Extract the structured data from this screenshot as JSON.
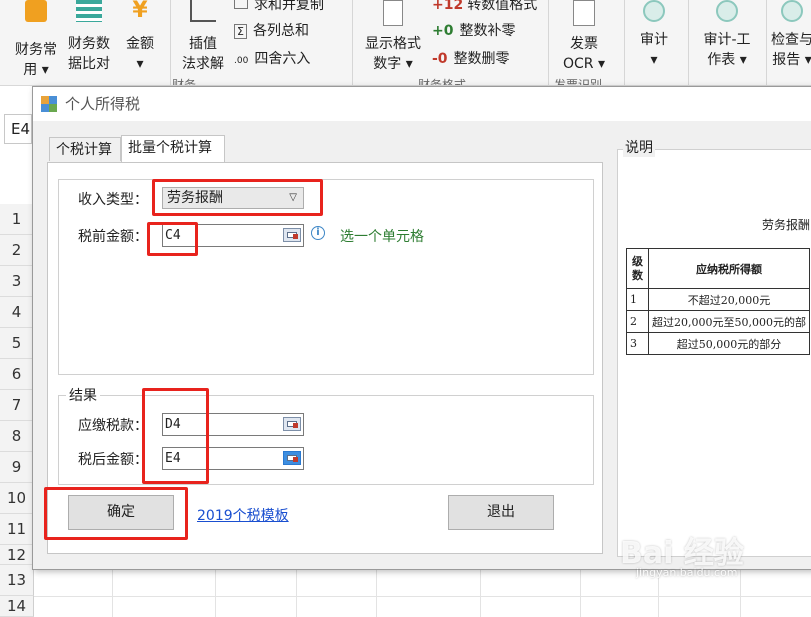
{
  "ribbon": {
    "buttons": [
      {
        "l1": "财务常",
        "l2": "用",
        "icon": "finance-common-icon"
      },
      {
        "l1": "财务数",
        "l2": "据比对",
        "icon": "data-compare-icon"
      },
      {
        "l1": "金额",
        "l2": "",
        "icon": "yen-icon"
      },
      {
        "l1": "插值",
        "l2": "法求解",
        "icon": "interpolation-icon"
      },
      {
        "l1": "显示格式",
        "l2": "数字",
        "icon": "display-format-icon"
      },
      {
        "l1": "发票",
        "l2": "OCR",
        "icon": "invoice-ocr-icon"
      },
      {
        "l1": "审计",
        "l2": "",
        "icon": "audit-icon"
      },
      {
        "l1": "审计-工",
        "l2": "作表",
        "icon": "audit-worksheet-icon"
      },
      {
        "l1": "检查与",
        "l2": "报告",
        "icon": "check-report-icon"
      }
    ],
    "small": [
      "求和并复制",
      "各列总和",
      "四舍六入",
      "转数值格式",
      "整数补零",
      "整数删零"
    ],
    "small_prefix": [
      "+12",
      "+0",
      "-0"
    ],
    "groups": [
      "财务",
      "财务格式",
      "发票识别"
    ],
    "colors": {
      "accent": "#f0a020",
      "teal": "#3aa89b",
      "red": "#e8231d"
    }
  },
  "sheet": {
    "namebox": "E4",
    "rows": [
      "1",
      "2",
      "3",
      "4",
      "5",
      "6",
      "7",
      "8",
      "9",
      "10",
      "11",
      "12",
      "13",
      "14"
    ]
  },
  "dialog": {
    "title": "个人所得税",
    "tabs": [
      "个税计算",
      "批量个税计算"
    ],
    "income_label": "收入类型：",
    "income_value": "劳务报酬",
    "pretax_label": "税前金额：",
    "pretax_value": "C4",
    "hint": "选一个单元格",
    "result_legend": "结果",
    "tax_label": "应缴税款：",
    "tax_value": "D4",
    "aftertax_label": "税后金额：",
    "aftertax_value": "E4",
    "ok_label": "确定",
    "template_link": "2019个税模板",
    "exit_label": "退出",
    "desc_legend": "说明",
    "desc_title": "劳务报酬",
    "table_headers": [
      "级数",
      "应纳税所得额"
    ],
    "table_rows": [
      {
        "level": "1",
        "range": "不超过20,000元"
      },
      {
        "level": "2",
        "range": "超过20,000元至50,000元的部"
      },
      {
        "level": "3",
        "range": "超过50,000元的部分"
      }
    ]
  },
  "watermark": {
    "brand": "Bai 经验",
    "sub": "jingyan.baidu.com"
  }
}
